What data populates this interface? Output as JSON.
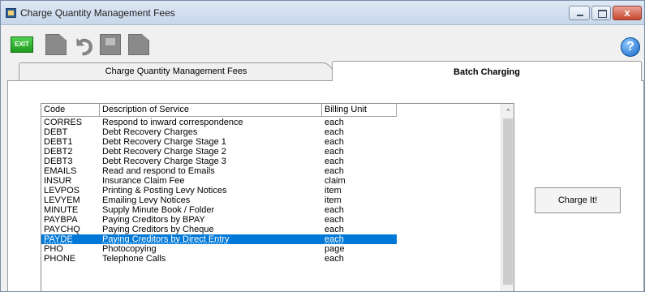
{
  "window": {
    "title": "Charge Quantity Management Fees",
    "close_glyph": "x"
  },
  "toolbar": {
    "exit_label": "EXIT",
    "help_glyph": "?"
  },
  "tabs": [
    {
      "label": "Charge Quantity Management Fees"
    },
    {
      "label": "Batch Charging"
    }
  ],
  "list": {
    "columns": [
      "Code",
      "Description of Service",
      "Billing Unit"
    ],
    "rows": [
      {
        "code": "CORRES",
        "desc": "Respond to inward correspondence",
        "unit": "each"
      },
      {
        "code": "DEBT",
        "desc": "Debt Recovery Charges",
        "unit": "each"
      },
      {
        "code": "DEBT1",
        "desc": "Debt Recovery Charge Stage 1",
        "unit": "each"
      },
      {
        "code": "DEBT2",
        "desc": "Debt Recovery Charge Stage 2",
        "unit": "each"
      },
      {
        "code": "DEBT3",
        "desc": "Debt Recovery Charge Stage 3",
        "unit": "each"
      },
      {
        "code": "EMAILS",
        "desc": "Read and respond to Emails",
        "unit": "each"
      },
      {
        "code": "INSUR",
        "desc": "Insurance Claim Fee",
        "unit": "claim"
      },
      {
        "code": "LEVPOS",
        "desc": "Printing & Posting Levy Notices",
        "unit": "item"
      },
      {
        "code": "LEVYEM",
        "desc": "Emailing Levy Notices",
        "unit": "item"
      },
      {
        "code": "MINUTE",
        "desc": "Supply Minute Book / Folder",
        "unit": "each"
      },
      {
        "code": "PAYBPA",
        "desc": "Paying Creditors by BPAY",
        "unit": "each"
      },
      {
        "code": "PAYCHQ",
        "desc": "Paying Creditors by Cheque",
        "unit": "each"
      },
      {
        "code": "PAYDE",
        "desc": "Paying Creditors by Direct Entry",
        "unit": "each"
      },
      {
        "code": "PHO",
        "desc": "Photocopying",
        "unit": "page"
      },
      {
        "code": "PHONE",
        "desc": "Telephone Calls",
        "unit": "each"
      }
    ],
    "scroll_up_glyph": "^"
  },
  "charge_button": {
    "label": "Charge It!"
  }
}
